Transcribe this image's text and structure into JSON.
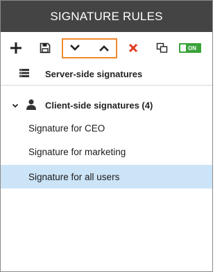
{
  "panel": {
    "title": "SIGNATURE RULES"
  },
  "toolbar": {
    "buttons": [
      {
        "name": "add-button",
        "icon": "plus-icon"
      },
      {
        "name": "save-button",
        "icon": "floppy-disk-icon"
      },
      {
        "name": "move-down-button",
        "icon": "chevron-down-icon"
      },
      {
        "name": "move-up-button",
        "icon": "chevron-up-icon"
      },
      {
        "name": "delete-button",
        "icon": "x-icon"
      },
      {
        "name": "duplicate-button",
        "icon": "copy-icon"
      }
    ],
    "toggle_label": "ON"
  },
  "sections": {
    "server": {
      "label": "Server-side signatures",
      "icon": "server-icon"
    },
    "client": {
      "label": "Client-side signatures (4)",
      "icon": "user-icon",
      "expanded": true
    }
  },
  "signatures": [
    {
      "label": "Signature for CEO",
      "selected": false
    },
    {
      "label": "Signature for marketing",
      "selected": false
    },
    {
      "label": "Signature for all users",
      "selected": true
    }
  ],
  "colors": {
    "titlebar": "#444444",
    "highlight": "#f08a2c",
    "delete": "#e03a1e",
    "toggle": "#3aa33a",
    "selected_row": "#cce4f7"
  }
}
